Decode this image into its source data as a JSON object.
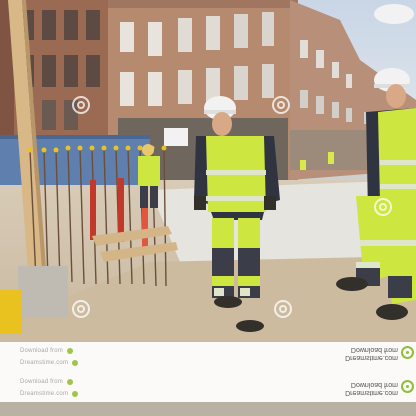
{
  "image": {
    "subject": "construction workers in hard hats and high-visibility vests on a building site",
    "accent_color": "#c9e83a",
    "watermark_color": "#8fbf3a"
  },
  "watermark": {
    "left_lines": [
      "Download from",
      "Dreamstime.com",
      "Download from",
      "Dreamstime.com"
    ],
    "right_block_1": [
      "Download from",
      "Dreamstime.com"
    ],
    "right_block_2": [
      "Download from",
      "Dreamstime.com"
    ]
  }
}
